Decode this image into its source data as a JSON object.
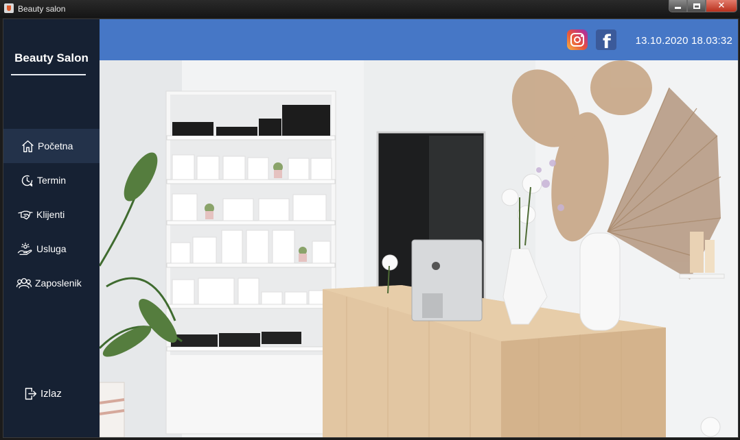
{
  "window": {
    "title": "Beauty salon"
  },
  "sidebar": {
    "brand": "Beauty Salon",
    "items": [
      {
        "label": "Početna",
        "icon": "home-icon",
        "active": true
      },
      {
        "label": "Termin",
        "icon": "clock-icon",
        "active": false
      },
      {
        "label": "Klijenti",
        "icon": "handshake-icon",
        "active": false
      },
      {
        "label": "Usluga",
        "icon": "service-hand-icon",
        "active": false
      },
      {
        "label": "Zaposlenik",
        "icon": "users-icon",
        "active": false
      }
    ],
    "exit_label": "Izlaz"
  },
  "header": {
    "datetime": "13.10.2020 18.03:32",
    "social": [
      "instagram-icon",
      "facebook-icon"
    ]
  },
  "colors": {
    "sidebar_bg": "#162133",
    "sidebar_active": "#23324a",
    "header_bg": "#4677c6"
  }
}
